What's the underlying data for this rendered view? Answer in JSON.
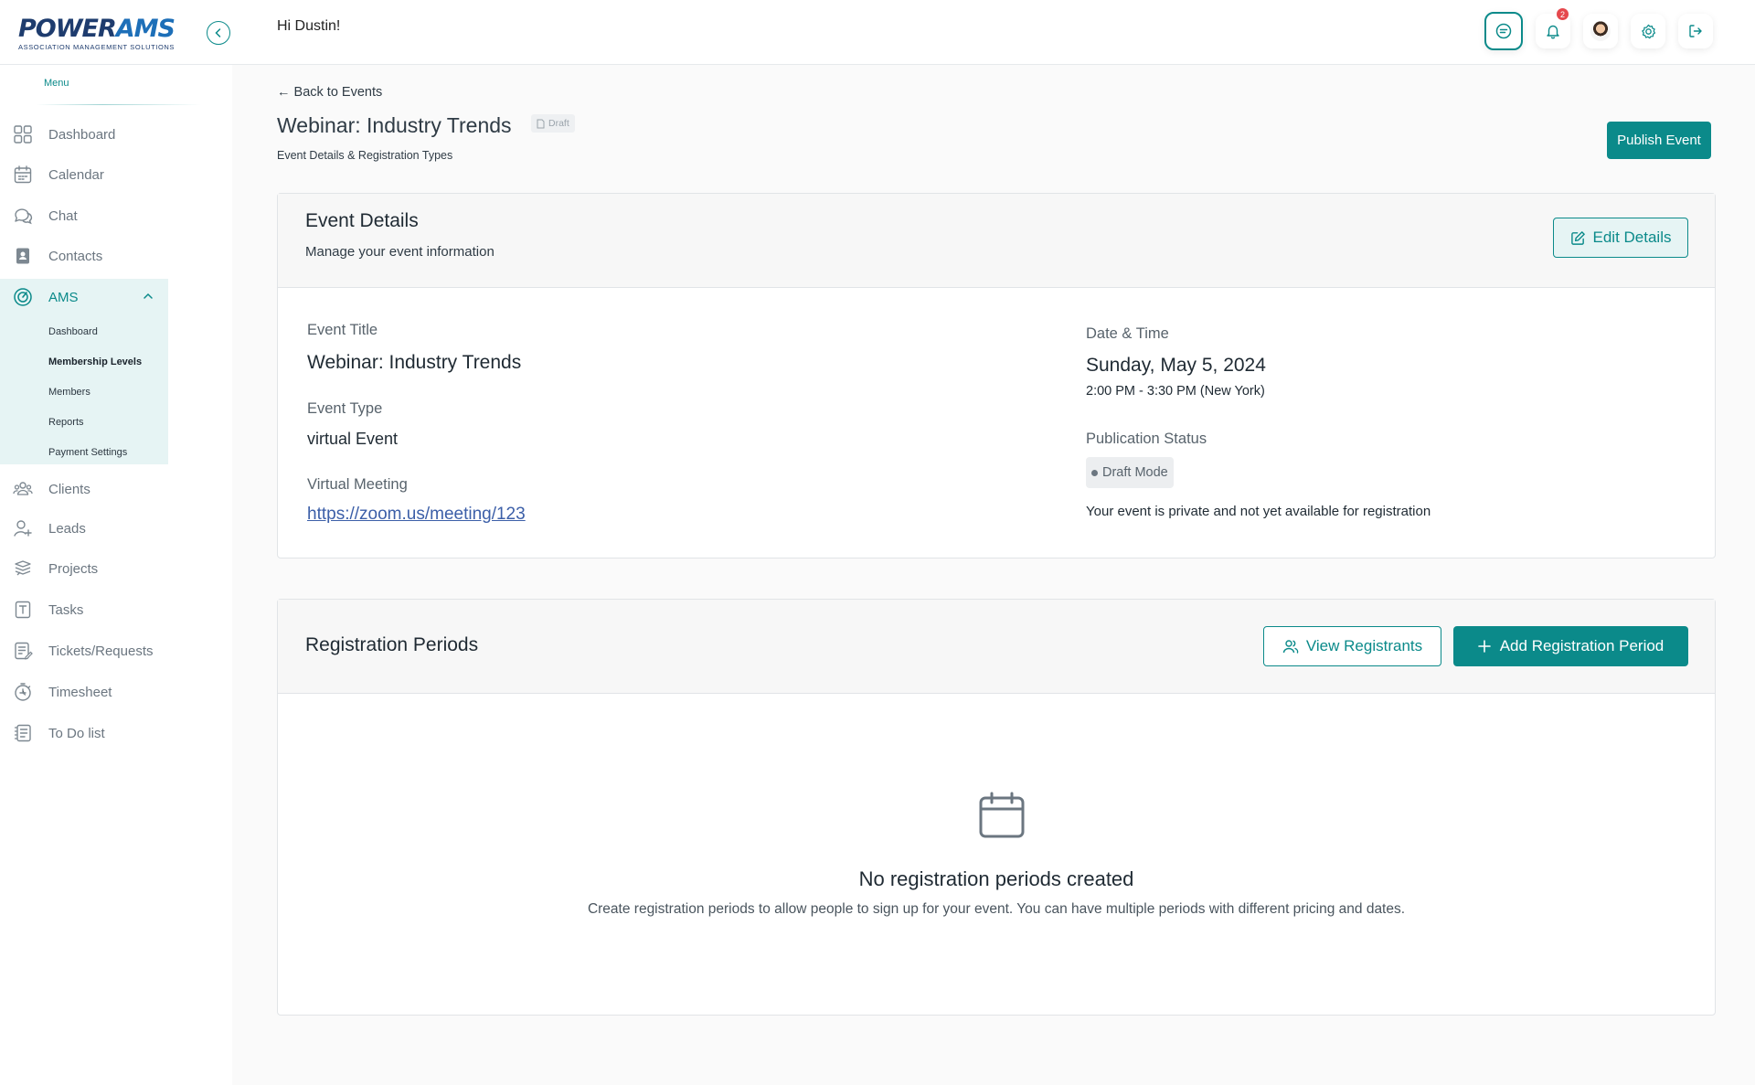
{
  "brand": {
    "logo_main_power": "POWER",
    "logo_main_ams": "AMS",
    "logo_sub": "ASSOCIATION MANAGEMENT SOLUTIONS",
    "accent_color": "#0b8a8a"
  },
  "header": {
    "greeting": "Hi Dustin!",
    "notification_count": "2",
    "icons": [
      "chat-icon",
      "bell-icon",
      "avatar",
      "gear-icon",
      "logout-icon"
    ]
  },
  "sidebar": {
    "menu_label": "Menu",
    "items_top": [
      {
        "label": "Dashboard",
        "icon": "dashboard-icon"
      },
      {
        "label": "Calendar",
        "icon": "calendar-icon"
      },
      {
        "label": "Chat",
        "icon": "chat-icon"
      },
      {
        "label": "Contacts",
        "icon": "contacts-icon"
      }
    ],
    "ams": {
      "label": "AMS",
      "sub_items": [
        "Dashboard",
        "Membership Levels",
        "Members",
        "Reports",
        "Payment Settings"
      ],
      "active_sub": "Membership Levels"
    },
    "items_bottom": [
      {
        "label": "Clients",
        "icon": "clients-icon"
      },
      {
        "label": "Leads",
        "icon": "leads-icon"
      },
      {
        "label": "Projects",
        "icon": "projects-icon"
      },
      {
        "label": "Tasks",
        "icon": "tasks-icon"
      },
      {
        "label": "Tickets/Requests",
        "icon": "tickets-icon"
      },
      {
        "label": "Timesheet",
        "icon": "timesheet-icon"
      },
      {
        "label": "To Do list",
        "icon": "todo-icon"
      }
    ]
  },
  "page": {
    "back_label": "← Back to Events",
    "title": "Webinar: Industry Trends",
    "draft_label": "Draft",
    "subtitle": "Event Details & Registration Types",
    "publish_label": "Publish Event"
  },
  "event_details": {
    "title": "Event Details",
    "description": "Manage your event information",
    "edit_label": "Edit Details",
    "event_title_label": "Event Title",
    "event_title_value": "Webinar: Industry Trends",
    "event_type_label": "Event Type",
    "event_type_value": "virtual Event",
    "virtual_meeting_label": "Virtual Meeting",
    "virtual_meeting_value": "https://zoom.us/meeting/123",
    "date_time_label": "Date & Time",
    "date_value": "Sunday, May 5, 2024",
    "time_value": "2:00 PM - 3:30 PM (New York)",
    "publication_status_label": "Publication Status",
    "status_value": "Draft Mode",
    "status_note": "Your event is private and not yet available for registration"
  },
  "registration_periods": {
    "title": "Registration Periods",
    "view_label": "View Registrants",
    "add_label": "Add Registration Period",
    "empty_title": "No registration periods created",
    "empty_desc": "Create registration periods to allow people to sign up for your event. You can have multiple periods with different pricing and dates."
  }
}
